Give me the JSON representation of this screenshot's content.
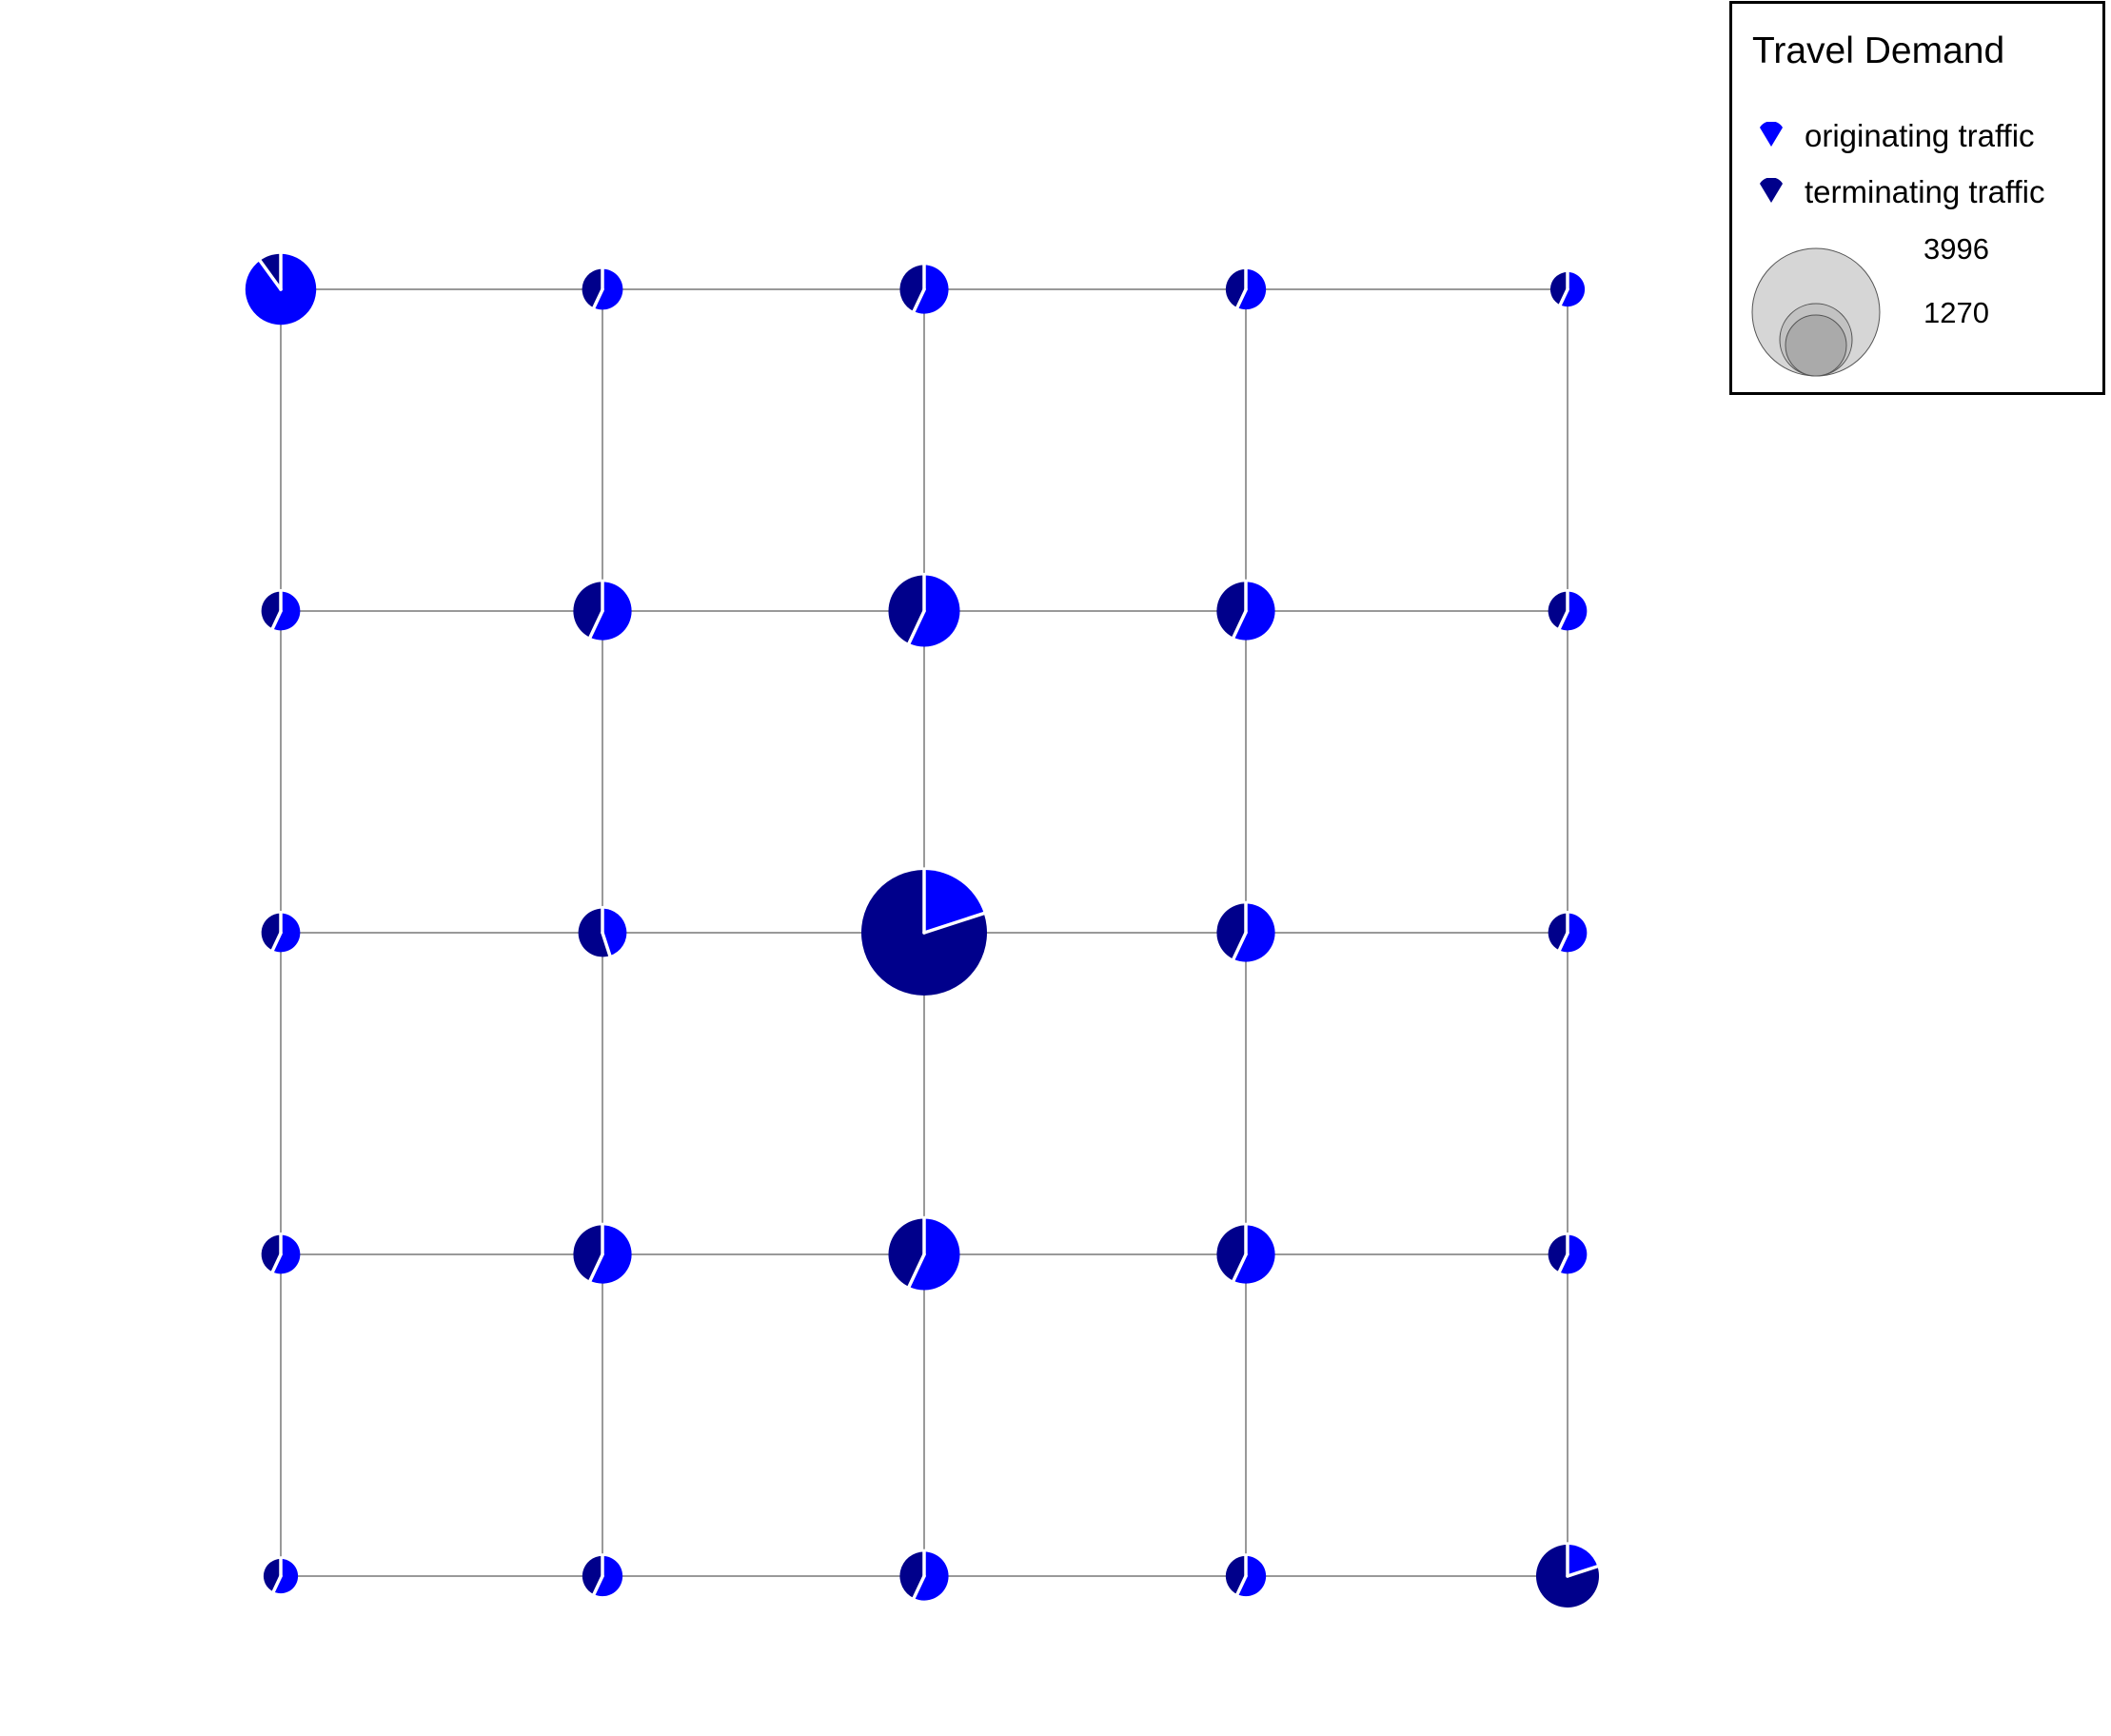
{
  "map": {
    "colors": {
      "originating": "#0000ff",
      "terminating": "#00008b",
      "edge": "#999999",
      "separator": "#ffffff"
    },
    "grid_rows": 5,
    "grid_cols": 5,
    "nodes": [
      {
        "row": 0,
        "col": 0,
        "total": 1270,
        "originating_share": 0.9
      },
      {
        "row": 0,
        "col": 1,
        "total": 420,
        "originating_share": 0.57
      },
      {
        "row": 0,
        "col": 2,
        "total": 600,
        "originating_share": 0.57
      },
      {
        "row": 0,
        "col": 3,
        "total": 410,
        "originating_share": 0.57
      },
      {
        "row": 0,
        "col": 4,
        "total": 300,
        "originating_share": 0.57
      },
      {
        "row": 1,
        "col": 0,
        "total": 380,
        "originating_share": 0.57
      },
      {
        "row": 1,
        "col": 1,
        "total": 860,
        "originating_share": 0.57
      },
      {
        "row": 1,
        "col": 2,
        "total": 1290,
        "originating_share": 0.57
      },
      {
        "row": 1,
        "col": 3,
        "total": 860,
        "originating_share": 0.57
      },
      {
        "row": 1,
        "col": 4,
        "total": 380,
        "originating_share": 0.57
      },
      {
        "row": 2,
        "col": 0,
        "total": 380,
        "originating_share": 0.57
      },
      {
        "row": 2,
        "col": 1,
        "total": 590,
        "originating_share": 0.45
      },
      {
        "row": 2,
        "col": 2,
        "total": 3996,
        "originating_share": 0.2
      },
      {
        "row": 2,
        "col": 3,
        "total": 860,
        "originating_share": 0.57
      },
      {
        "row": 2,
        "col": 4,
        "total": 380,
        "originating_share": 0.57
      },
      {
        "row": 3,
        "col": 0,
        "total": 380,
        "originating_share": 0.57
      },
      {
        "row": 3,
        "col": 1,
        "total": 860,
        "originating_share": 0.57
      },
      {
        "row": 3,
        "col": 2,
        "total": 1290,
        "originating_share": 0.57
      },
      {
        "row": 3,
        "col": 3,
        "total": 860,
        "originating_share": 0.57
      },
      {
        "row": 3,
        "col": 4,
        "total": 380,
        "originating_share": 0.57
      },
      {
        "row": 4,
        "col": 0,
        "total": 300,
        "originating_share": 0.57
      },
      {
        "row": 4,
        "col": 1,
        "total": 410,
        "originating_share": 0.57
      },
      {
        "row": 4,
        "col": 2,
        "total": 600,
        "originating_share": 0.57
      },
      {
        "row": 4,
        "col": 3,
        "total": 410,
        "originating_share": 0.57
      },
      {
        "row": 4,
        "col": 4,
        "total": 1000,
        "originating_share": 0.2
      }
    ]
  },
  "legend": {
    "title": "Travel Demand",
    "originating_label": "originating traffic",
    "terminating_label": "terminating traffic",
    "size_max_label": "3996",
    "size_mid_label": "1270",
    "size_values": [
      3996,
      1270
    ],
    "size_circle_fill": "#bbbbbb"
  }
}
